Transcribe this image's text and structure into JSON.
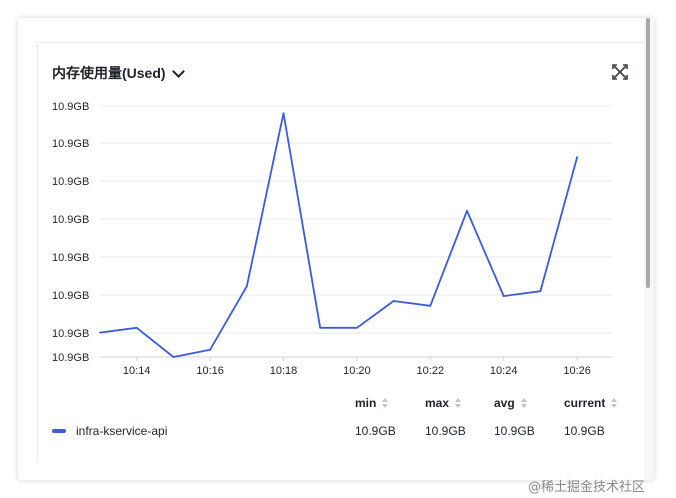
{
  "panel": {
    "title": "内存使用量(Used)",
    "icons": {
      "dropdown": "chevron-down-icon",
      "expand": "expand-icon"
    }
  },
  "chart_data": {
    "type": "line",
    "x": [
      "10:13",
      "10:14",
      "10:15",
      "10:16",
      "10:17",
      "10:18",
      "10:19",
      "10:20",
      "10:21",
      "10:22",
      "10:23",
      "10:24",
      "10:25",
      "10:26"
    ],
    "x_tick_labels": [
      "10:14",
      "10:16",
      "10:18",
      "10:20",
      "10:22",
      "10:24",
      "10:26"
    ],
    "y_tick_labels": [
      "10.9GB",
      "10.9GB",
      "10.9GB",
      "10.9GB",
      "10.9GB",
      "10.9GB",
      "10.9GB",
      "10.9GB"
    ],
    "series": [
      {
        "name": "infra-kservice-api",
        "color": "#3b5bdb",
        "values": [
          0.1,
          0.12,
          0.0,
          0.03,
          0.29,
          1.0,
          0.12,
          0.12,
          0.23,
          0.21,
          0.6,
          0.25,
          0.27,
          0.82
        ]
      }
    ],
    "ylim": [
      0,
      1.03
    ],
    "grid": true,
    "legend_placement": "bottom"
  },
  "legend": {
    "headers": {
      "min": "min",
      "max": "max",
      "avg": "avg",
      "current": "current"
    },
    "rows": [
      {
        "name": "infra-kservice-api",
        "min": "10.9GB",
        "max": "10.9GB",
        "avg": "10.9GB",
        "current": "10.9GB"
      }
    ]
  },
  "watermark": "@稀土掘金技术社区"
}
